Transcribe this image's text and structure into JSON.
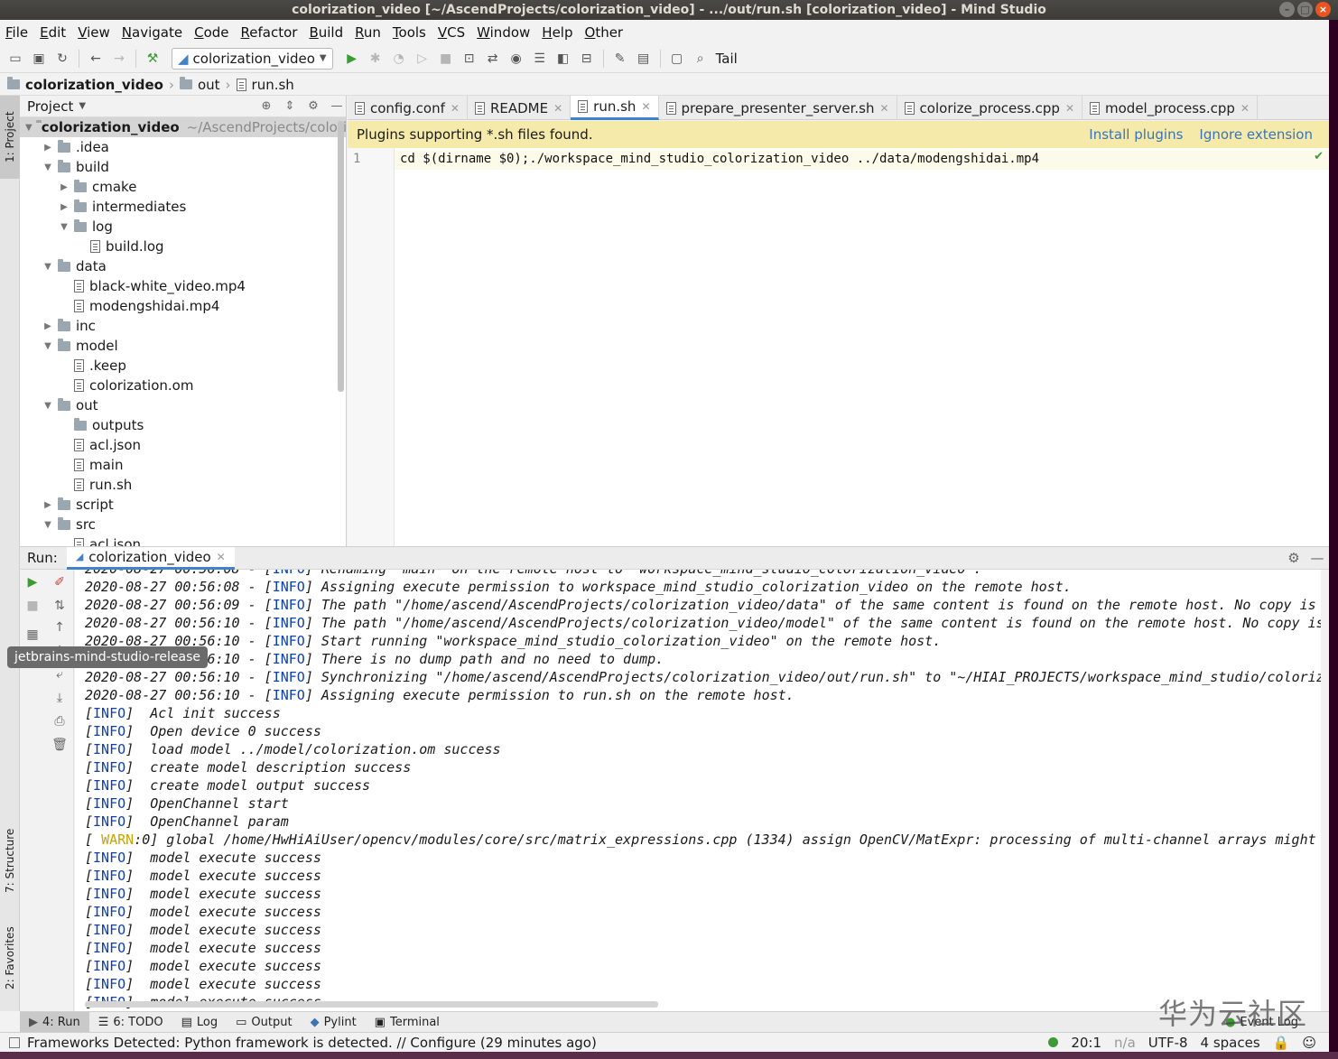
{
  "window": {
    "title": "colorization_video [~/AscendProjects/colorization_video] - .../out/run.sh [colorization_video] - Mind Studio"
  },
  "menu": [
    "File",
    "Edit",
    "View",
    "Navigate",
    "Code",
    "Refactor",
    "Build",
    "Run",
    "Tools",
    "VCS",
    "Window",
    "Help",
    "Other"
  ],
  "toolbar": {
    "run_config": "colorization_video",
    "tail_label": "Tail"
  },
  "breadcrumb": [
    "colorization_video",
    "out",
    "run.sh"
  ],
  "left_strip": {
    "project_tab": "1: Project",
    "structure_tab": "7: Structure",
    "favorites_tab": "2: Favorites"
  },
  "project": {
    "header": "Project",
    "tree": [
      {
        "name": "colorization_video",
        "path": "~/AscendProjects/colorizat",
        "level": 0,
        "type": "folder",
        "expanded": true,
        "bold": true
      },
      {
        "name": ".idea",
        "level": 1,
        "type": "folder",
        "expanded": false
      },
      {
        "name": "build",
        "level": 1,
        "type": "folder",
        "expanded": true
      },
      {
        "name": "cmake",
        "level": 2,
        "type": "folder",
        "expanded": false
      },
      {
        "name": "intermediates",
        "level": 2,
        "type": "folder",
        "expanded": false
      },
      {
        "name": "log",
        "level": 2,
        "type": "folder",
        "expanded": true
      },
      {
        "name": "build.log",
        "level": 3,
        "type": "file"
      },
      {
        "name": "data",
        "level": 1,
        "type": "folder",
        "expanded": true
      },
      {
        "name": "black-white_video.mp4",
        "level": 2,
        "type": "file"
      },
      {
        "name": "modengshidai.mp4",
        "level": 2,
        "type": "file"
      },
      {
        "name": "inc",
        "level": 1,
        "type": "folder",
        "expanded": false
      },
      {
        "name": "model",
        "level": 1,
        "type": "folder",
        "expanded": true
      },
      {
        "name": ".keep",
        "level": 2,
        "type": "file"
      },
      {
        "name": "colorization.om",
        "level": 2,
        "type": "file"
      },
      {
        "name": "out",
        "level": 1,
        "type": "folder",
        "expanded": true
      },
      {
        "name": "outputs",
        "level": 2,
        "type": "folder",
        "leaf": true
      },
      {
        "name": "acl.json",
        "level": 2,
        "type": "file"
      },
      {
        "name": "main",
        "level": 2,
        "type": "file"
      },
      {
        "name": "run.sh",
        "level": 2,
        "type": "file"
      },
      {
        "name": "script",
        "level": 1,
        "type": "folder",
        "expanded": false
      },
      {
        "name": "src",
        "level": 1,
        "type": "folder",
        "expanded": true
      },
      {
        "name": "acl.json",
        "level": 2,
        "type": "file"
      }
    ]
  },
  "editor": {
    "tabs": [
      {
        "label": "config.conf",
        "active": false
      },
      {
        "label": "README",
        "active": false
      },
      {
        "label": "run.sh",
        "active": true
      },
      {
        "label": "prepare_presenter_server.sh",
        "active": false
      },
      {
        "label": "colorize_process.cpp",
        "active": false
      },
      {
        "label": "model_process.cpp",
        "active": false
      }
    ],
    "plugin_notice": "Plugins supporting *.sh files found.",
    "install_plugins": "Install plugins",
    "ignore_extension": "Ignore extension",
    "line_number": "1",
    "code": "cd $(dirname $0);./workspace_mind_studio_colorization_video ../data/modengshidai.mp4"
  },
  "run": {
    "label": "Run:",
    "tab": "colorization_video",
    "tooltip": "jetbrains-mind-studio-release",
    "lines": [
      {
        "prefix": "2020-08-27 00:56:08 - [",
        "tag": "INFO",
        "tag_type": "info",
        "text": "] Renaming \"main\" on the remote host to \"workspace_mind_studio_colorization_video\"."
      },
      {
        "prefix": "2020-08-27 00:56:08 - [",
        "tag": "INFO",
        "tag_type": "info",
        "text": "] Assigning execute permission to workspace_mind_studio_colorization_video on the remote host."
      },
      {
        "prefix": "2020-08-27 00:56:09 - [",
        "tag": "INFO",
        "tag_type": "info",
        "text": "] The path \"/home/ascend/AscendProjects/colorization_video/data\" of the same content is found on the remote host. No copy is"
      },
      {
        "prefix": "2020-08-27 00:56:10 - [",
        "tag": "INFO",
        "tag_type": "info",
        "text": "] The path \"/home/ascend/AscendProjects/colorization_video/model\" of the same content is found on the remote host. No copy is"
      },
      {
        "prefix": "2020-08-27 00:56:10 - [",
        "tag": "INFO",
        "tag_type": "info",
        "text": "] Start running \"workspace_mind_studio_colorization_video\" on the remote host."
      },
      {
        "prefix": "2020-08-27 00:56:10 - [",
        "tag": "INFO",
        "tag_type": "info",
        "text": "] There is no dump path and no need to dump."
      },
      {
        "prefix": "2020-08-27 00:56:10 - [",
        "tag": "INFO",
        "tag_type": "info",
        "text": "] Synchronizing \"/home/ascend/AscendProjects/colorization_video/out/run.sh\" to \"~/HIAI_PROJECTS/workspace_mind_studio/coloriz"
      },
      {
        "prefix": "2020-08-27 00:56:10 - [",
        "tag": "INFO",
        "tag_type": "info",
        "text": "] Assigning execute permission to run.sh on the remote host."
      },
      {
        "prefix": "[",
        "tag": "INFO",
        "tag_type": "info",
        "text": "]  Acl init success"
      },
      {
        "prefix": "[",
        "tag": "INFO",
        "tag_type": "info",
        "text": "]  Open device 0 success"
      },
      {
        "prefix": "[",
        "tag": "INFO",
        "tag_type": "info",
        "text": "]  load model ../model/colorization.om success"
      },
      {
        "prefix": "[",
        "tag": "INFO",
        "tag_type": "info",
        "text": "]  create model description success"
      },
      {
        "prefix": "[",
        "tag": "INFO",
        "tag_type": "info",
        "text": "]  create model output success"
      },
      {
        "prefix": "[",
        "tag": "INFO",
        "tag_type": "info",
        "text": "]  OpenChannel start"
      },
      {
        "prefix": "[",
        "tag": "INFO",
        "tag_type": "info",
        "text": "]  OpenChannel param"
      },
      {
        "prefix": "[ ",
        "tag": "WARN",
        "tag_type": "warn",
        "text": ":0] global /home/HwHiAiUser/opencv/modules/core/src/matrix_expressions.cpp (1334) assign OpenCV/MatExpr: processing of multi-channel arrays might"
      },
      {
        "prefix": "[",
        "tag": "INFO",
        "tag_type": "info",
        "text": "]  model execute success"
      },
      {
        "prefix": "[",
        "tag": "INFO",
        "tag_type": "info",
        "text": "]  model execute success"
      },
      {
        "prefix": "[",
        "tag": "INFO",
        "tag_type": "info",
        "text": "]  model execute success"
      },
      {
        "prefix": "[",
        "tag": "INFO",
        "tag_type": "info",
        "text": "]  model execute success"
      },
      {
        "prefix": "[",
        "tag": "INFO",
        "tag_type": "info",
        "text": "]  model execute success"
      },
      {
        "prefix": "[",
        "tag": "INFO",
        "tag_type": "info",
        "text": "]  model execute success"
      },
      {
        "prefix": "[",
        "tag": "INFO",
        "tag_type": "info",
        "text": "]  model execute success"
      },
      {
        "prefix": "[",
        "tag": "INFO",
        "tag_type": "info",
        "text": "]  model execute success"
      },
      {
        "prefix": "[",
        "tag": "INFO",
        "tag_type": "info",
        "text": "]  model execute success"
      }
    ]
  },
  "bottom_tools": [
    "4: Run",
    "6: TODO",
    "Log",
    "Output",
    "Pylint",
    "Terminal",
    "Event Log"
  ],
  "status": {
    "message": "Frameworks Detected: Python framework is detected. // Configure (29 minutes ago)",
    "position": "20:1",
    "na": "n/a",
    "encoding": "UTF-8",
    "indent": "4 spaces"
  },
  "watermark": "华为云社区",
  "colors": {
    "accent": "#4083c9",
    "info_tag": "#0b3fb5",
    "warn_tag": "#c8a400",
    "plugin_bar": "#f5eaaa",
    "ubuntu_close": "#e95420"
  }
}
